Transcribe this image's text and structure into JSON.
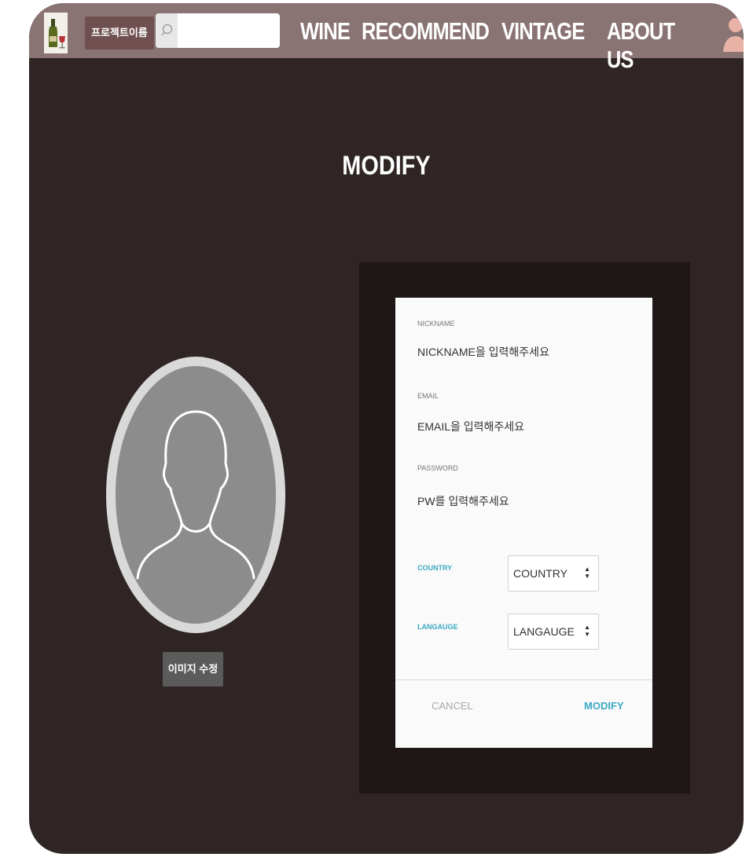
{
  "header": {
    "project_name": "프로젝트이름",
    "search": {
      "placeholder": ""
    },
    "nav": [
      "WINE",
      "RECOMMEND",
      "VINTAGE",
      "ABOUT US"
    ]
  },
  "page": {
    "title": "MODIFY"
  },
  "profile": {
    "edit_image_label": "이미지 수정"
  },
  "form": {
    "nickname": {
      "label": "NICKNAME",
      "placeholder": "NICKNAME을 입력해주세요"
    },
    "email": {
      "label": "EMAIL",
      "placeholder": "EMAIL을 입력해주세요"
    },
    "password": {
      "label": "PASSWORD",
      "placeholder": "PW를 입력해주세요"
    },
    "country": {
      "label": "COUNTRY",
      "value": "COUNTRY"
    },
    "language": {
      "label": "LANGAUGE",
      "value": "LANGAUGE"
    },
    "cancel_label": "CANCEL",
    "submit_label": "MODIFY"
  },
  "colors": {
    "topbar": "#8a7373",
    "background": "#2f2524",
    "panel": "#1e1716",
    "accent": "#3aa8c4"
  }
}
